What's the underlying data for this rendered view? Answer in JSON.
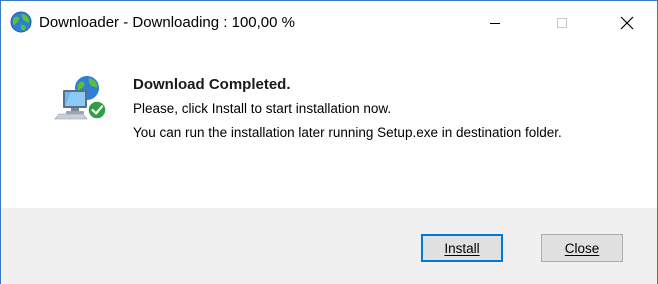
{
  "window": {
    "title": "Downloader - Downloading : 100,00 %",
    "app_icon": "globe-icon",
    "controls": {
      "minimize": "minimize-icon",
      "maximize": "maximize-icon",
      "close": "close-icon"
    }
  },
  "message": {
    "icon": "network-computer-check-icon",
    "heading": "Download Completed.",
    "line1": "Please, click Install to start installation now.",
    "line2": "You can run the installation later running Setup.exe in destination folder."
  },
  "buttons": {
    "install": "Install",
    "close": "Close"
  },
  "colors": {
    "accent": "#0078d7",
    "footer_bg": "#f0f0f0",
    "button_bg": "#e1e1e1"
  }
}
